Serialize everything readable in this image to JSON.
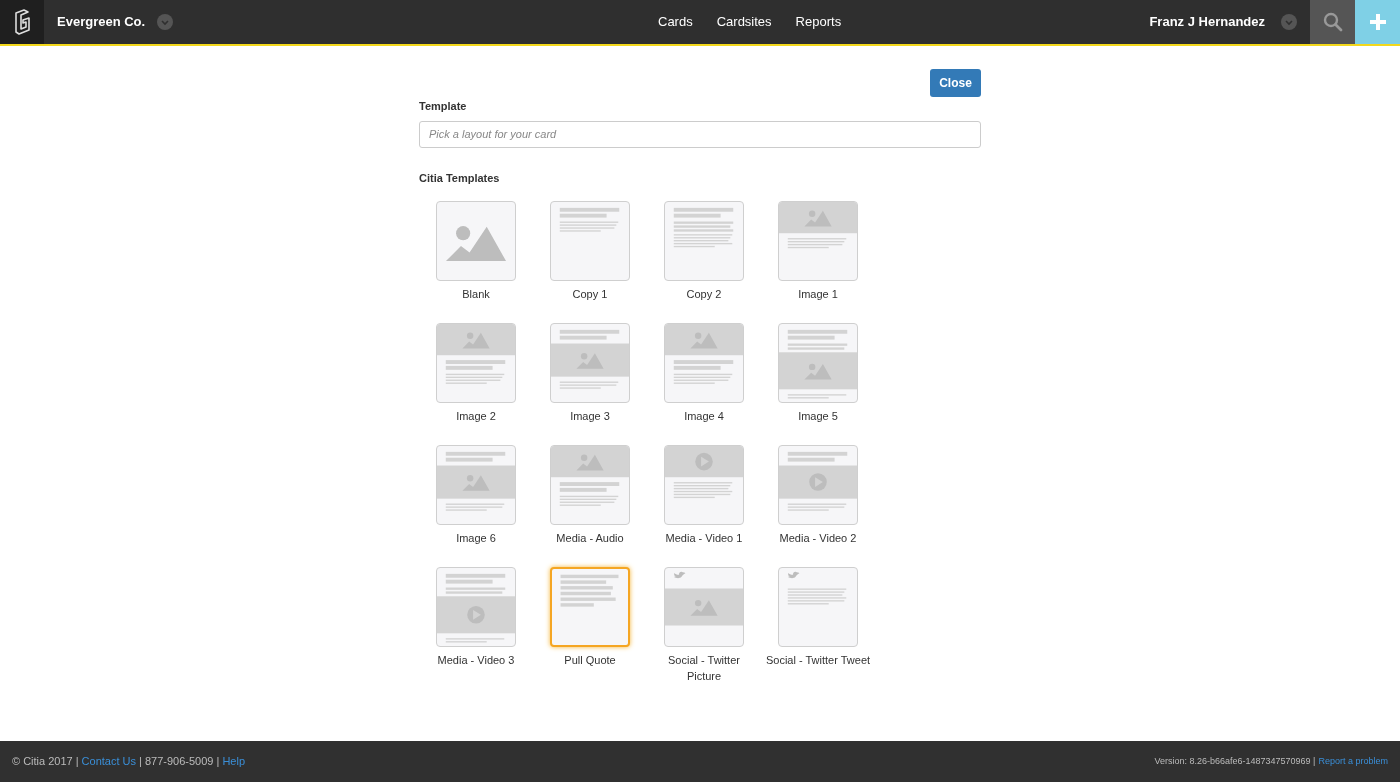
{
  "header": {
    "org": "Evergreen Co.",
    "nav": [
      {
        "label": "Cards"
      },
      {
        "label": "Cardsites"
      },
      {
        "label": "Reports"
      }
    ],
    "user": "Franz J Hernandez"
  },
  "close_button": "Close",
  "template_field": {
    "label": "Template",
    "placeholder": "Pick a layout for your card"
  },
  "section_title": "Citia Templates",
  "templates": [
    {
      "label": "Blank",
      "kind": "blank",
      "selected": false
    },
    {
      "label": "Copy 1",
      "kind": "copy",
      "selected": false
    },
    {
      "label": "Copy 2",
      "kind": "article",
      "selected": false
    },
    {
      "label": "Image 1",
      "kind": "photo",
      "selected": false
    },
    {
      "label": "Image 2",
      "kind": "photostory",
      "selected": false
    },
    {
      "label": "Image 3",
      "kind": "photomid",
      "selected": false
    },
    {
      "label": "Image 4",
      "kind": "photostory",
      "selected": false
    },
    {
      "label": "Image 5",
      "kind": "photolower",
      "selected": false
    },
    {
      "label": "Image 6",
      "kind": "photomid",
      "selected": false
    },
    {
      "label": "Media - Audio",
      "kind": "photostory",
      "selected": false
    },
    {
      "label": "Media - Video 1",
      "kind": "video",
      "selected": false
    },
    {
      "label": "Media - Video 2",
      "kind": "videomid",
      "selected": false
    },
    {
      "label": "Media - Video 3",
      "kind": "videolower",
      "selected": false
    },
    {
      "label": "Pull Quote",
      "kind": "quote",
      "selected": true
    },
    {
      "label": "Social - Twitter Picture",
      "kind": "tweetphoto",
      "selected": false
    },
    {
      "label": "Social - Twitter Tweet",
      "kind": "tweet",
      "selected": false
    }
  ],
  "footer": {
    "copyright": "© Citia 2017 |",
    "contact": "Contact Us",
    "phone": "| 877-906-5009 |",
    "help": "Help",
    "version": "Version: 8.26-b66afe6-1487347570969 |",
    "report": "Report a problem"
  }
}
